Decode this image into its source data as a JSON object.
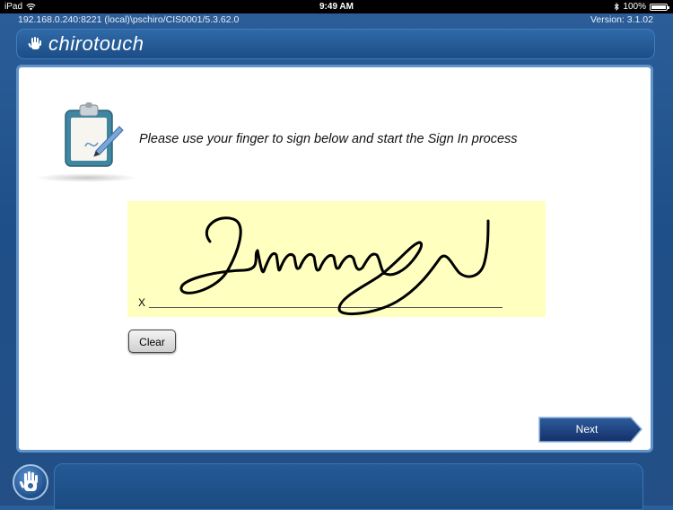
{
  "status_bar": {
    "device": "iPad",
    "time": "9:49 AM",
    "battery": "100%"
  },
  "info": {
    "connection": "192.168.0.240:8221 (local)\\pschiro/CIS0001/5.3.62.0",
    "version": "Version: 3.1.02"
  },
  "header": {
    "logo_text": "chirotouch"
  },
  "main": {
    "prompt": "Please use your finger to sign below and start the Sign In process",
    "signature_x": "X",
    "clear_label": "Clear",
    "next_label": "Next"
  },
  "colors": {
    "background": "#1f4f88",
    "panel_border": "#5f93c9",
    "signature_pad": "#ffffc0",
    "next_button": "#1f3f78"
  },
  "icons": {
    "wifi": "wifi-icon",
    "bluetooth": "bluetooth-icon",
    "battery": "battery-icon",
    "logo": "hand-logo-icon",
    "clipboard": "clipboard-pen-icon",
    "home": "hand-home-icon"
  }
}
